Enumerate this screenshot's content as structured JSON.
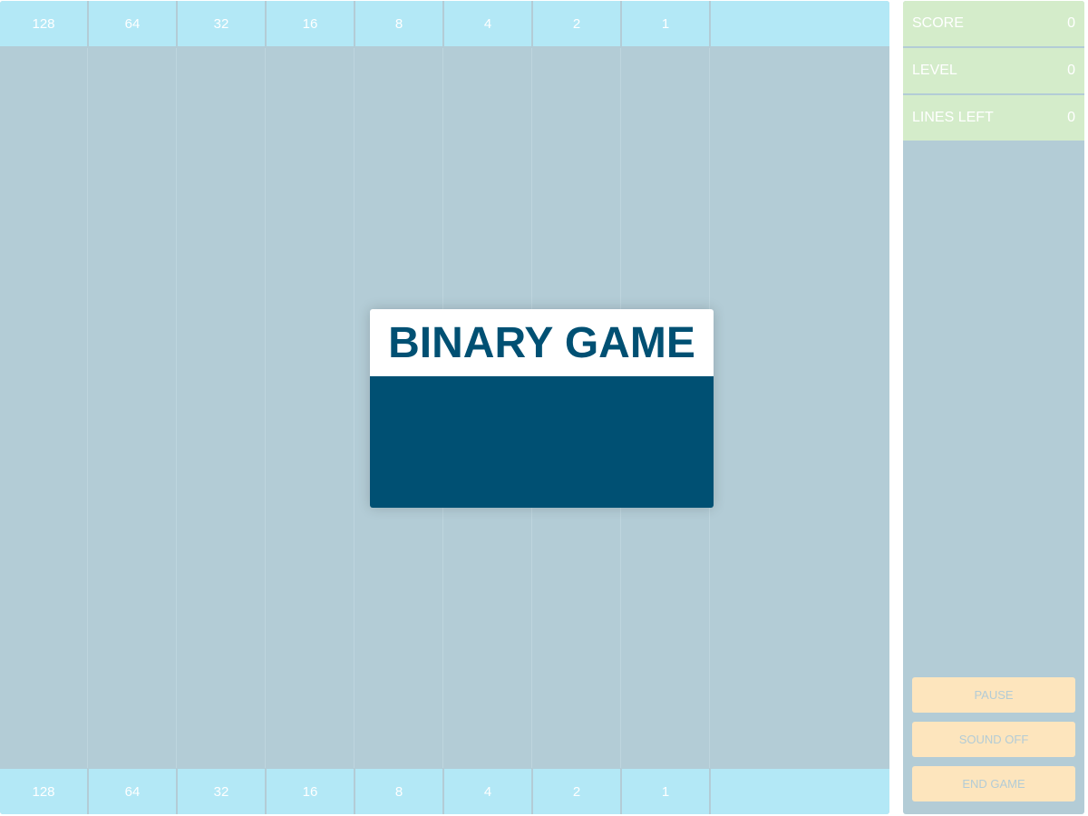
{
  "bit_labels": [
    "128",
    "64",
    "32",
    "16",
    "8",
    "4",
    "2",
    "1",
    ""
  ],
  "modal": {
    "title": "BINARY GAME"
  },
  "stats": [
    {
      "label": "SCORE",
      "value": "0"
    },
    {
      "label": "LEVEL",
      "value": "0"
    },
    {
      "label": "LINES LEFT",
      "value": "0"
    }
  ],
  "controls": {
    "pause_label": "PAUSE",
    "sound_label": "SOUND OFF",
    "end_label": "END GAME"
  },
  "colors": {
    "board_bg": "#b3ccd6",
    "bit_cell": "#b3e8f6",
    "stat_bg": "#d4ecca",
    "button_bg": "#fde5bd",
    "modal_blue": "#005073"
  }
}
